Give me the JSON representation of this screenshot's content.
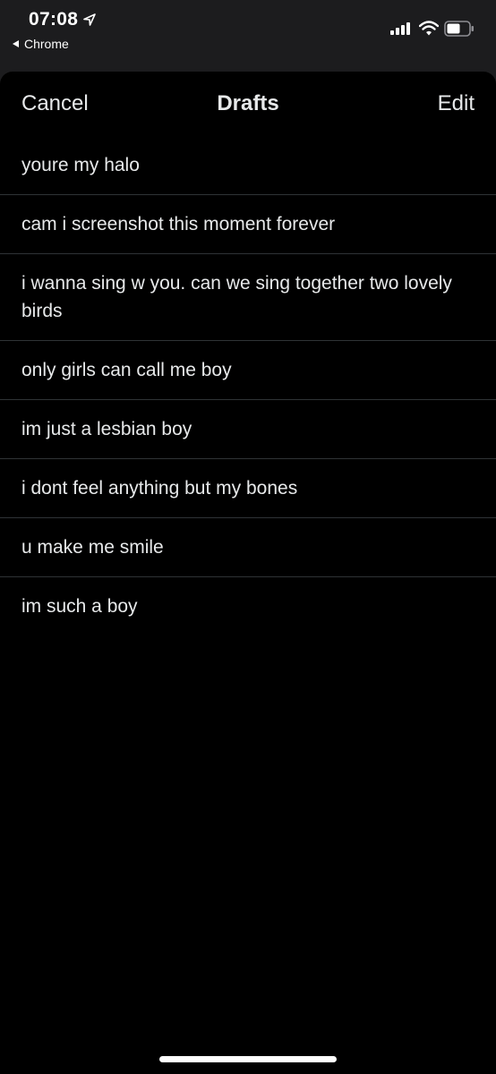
{
  "status_bar": {
    "time": "07:08",
    "back_app": "Chrome",
    "icons": [
      "location-arrow-icon",
      "signal-icon",
      "wifi-icon",
      "battery-icon"
    ]
  },
  "nav": {
    "cancel_label": "Cancel",
    "title": "Drafts",
    "edit_label": "Edit"
  },
  "drafts": [
    "youre my halo",
    "cam i screenshot this moment forever",
    "i wanna sing w you. can we sing together  two lovely birds",
    "only girls can call me boy",
    "im just a lesbian boy",
    "i dont feel anything but my bones",
    "u make me smile",
    "im such a boy"
  ],
  "colors": {
    "background": "#000000",
    "status_bar": "#1c1c1e",
    "text": "#e7e9ea",
    "divider": "#2f3336"
  }
}
